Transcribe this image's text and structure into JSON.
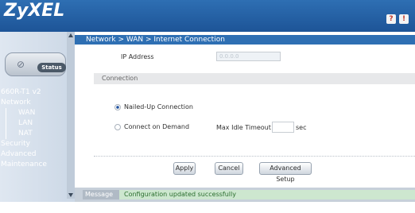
{
  "header": {
    "logo": "ZyXEL",
    "help_icon": "?",
    "tools_icon": "!"
  },
  "sidebar": {
    "status_button": "Status",
    "items": [
      {
        "label": "660R-T1 v2",
        "type": "top"
      },
      {
        "label": "Network",
        "type": "top"
      },
      {
        "label": "WAN",
        "type": "sub"
      },
      {
        "label": "LAN",
        "type": "sub"
      },
      {
        "label": "NAT",
        "type": "sub"
      },
      {
        "label": "Security",
        "type": "top"
      },
      {
        "label": "Advanced",
        "type": "top"
      },
      {
        "label": "Maintenance",
        "type": "top"
      }
    ]
  },
  "breadcrumb": "Network > WAN > Internet Connection",
  "form": {
    "ip_label": "IP Address",
    "ip_value": "0.0.0.0",
    "section_title": "Connection",
    "radio_nailed": "Nailed-Up Connection",
    "radio_demand": "Connect on Demand",
    "timeout_label": "Max Idle Timeout",
    "timeout_unit": "sec",
    "timeout_value": ""
  },
  "buttons": {
    "apply": "Apply",
    "cancel": "Cancel",
    "advanced": "Advanced Setup"
  },
  "message": {
    "label": "Message",
    "text": "Configuration updated successfully"
  },
  "colors": {
    "header_blue": "#1d5497",
    "message_green": "#cde7cf"
  }
}
